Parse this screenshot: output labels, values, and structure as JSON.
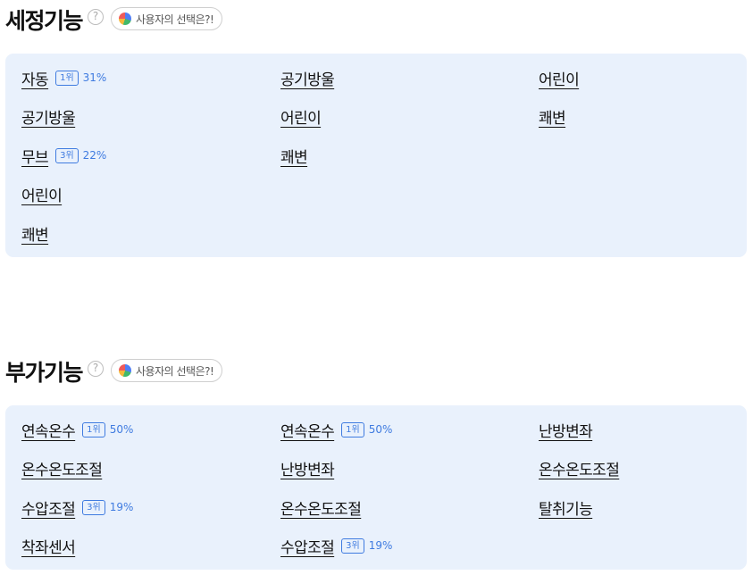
{
  "sections": [
    {
      "title": "세정기능",
      "pill_label": "사용자의 선택은?!",
      "help_glyph": "?",
      "columns": [
        [
          {
            "label": "자동",
            "rank": "1위",
            "pct": "31%"
          },
          {
            "label": "공기방울"
          },
          {
            "label": "무브",
            "rank": "3위",
            "pct": "22%"
          },
          {
            "label": "어린이"
          },
          {
            "label": "쾌변"
          }
        ],
        [
          {
            "label": "공기방울"
          },
          {
            "label": "어린이"
          },
          {
            "label": "쾌변"
          }
        ],
        [
          {
            "label": "어린이"
          },
          {
            "label": "쾌변"
          }
        ]
      ]
    },
    {
      "title": "부가기능",
      "pill_label": "사용자의 선택은?!",
      "help_glyph": "?",
      "columns": [
        [
          {
            "label": "연속온수",
            "rank": "1위",
            "pct": "50%"
          },
          {
            "label": "온수온도조절"
          },
          {
            "label": "수압조절",
            "rank": "3위",
            "pct": "19%"
          },
          {
            "label": "착좌센서"
          }
        ],
        [
          {
            "label": "연속온수",
            "rank": "1위",
            "pct": "50%"
          },
          {
            "label": "난방변좌"
          },
          {
            "label": "온수온도조절"
          },
          {
            "label": "수압조절",
            "rank": "3위",
            "pct": "19%"
          }
        ],
        [
          {
            "label": "난방변좌"
          },
          {
            "label": "온수온도조절"
          },
          {
            "label": "탈취기능"
          }
        ]
      ]
    }
  ],
  "colors": {
    "panel_bg": "#e9f1fc",
    "accent": "#3f7be0",
    "text": "#111111"
  }
}
